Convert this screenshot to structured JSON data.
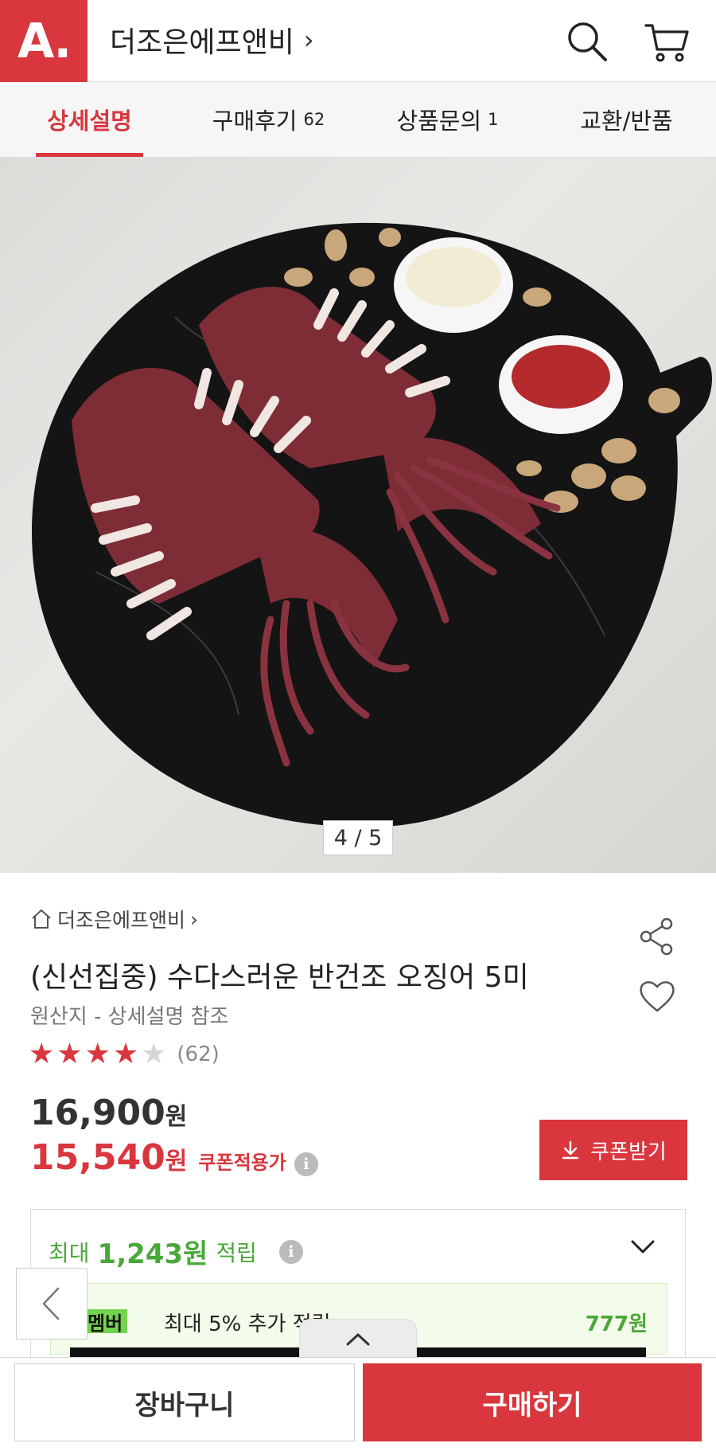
{
  "header": {
    "logo": "A.",
    "store_title": "더조은에프앤비",
    "chevron": "›"
  },
  "tabs": [
    {
      "label": "상세설명",
      "count": ""
    },
    {
      "label": "구매후기",
      "count": "62"
    },
    {
      "label": "상품문의",
      "count": "1"
    },
    {
      "label": "교환/반품",
      "count": ""
    }
  ],
  "gallery": {
    "indicator": "4 / 5"
  },
  "product": {
    "breadcrumb": "더조은에프앤비",
    "breadcrumb_chevron": "›",
    "title": "(신선집중) 수다스러운 반건조 오징어 5미",
    "origin": "원산지 - 상세설명 참조",
    "rating_value": 4.5,
    "rating_count": "(62)",
    "original_price": "16,900",
    "sale_price": "15,540",
    "currency": "원",
    "coupon_tag": "쿠폰적용가",
    "coupon_button": "쿠폰받기"
  },
  "points": {
    "prefix": "최대",
    "amount": "1,243원",
    "suffix": "적립",
    "member_badge": "멤버",
    "member_text": "최대 5% 추가 적립",
    "member_amount": "777원"
  },
  "bottom": {
    "cart_label": "장바구니",
    "buy_label": "구매하기"
  },
  "colors": {
    "brand_red": "#d9363e",
    "points_green": "#4aa83a"
  }
}
